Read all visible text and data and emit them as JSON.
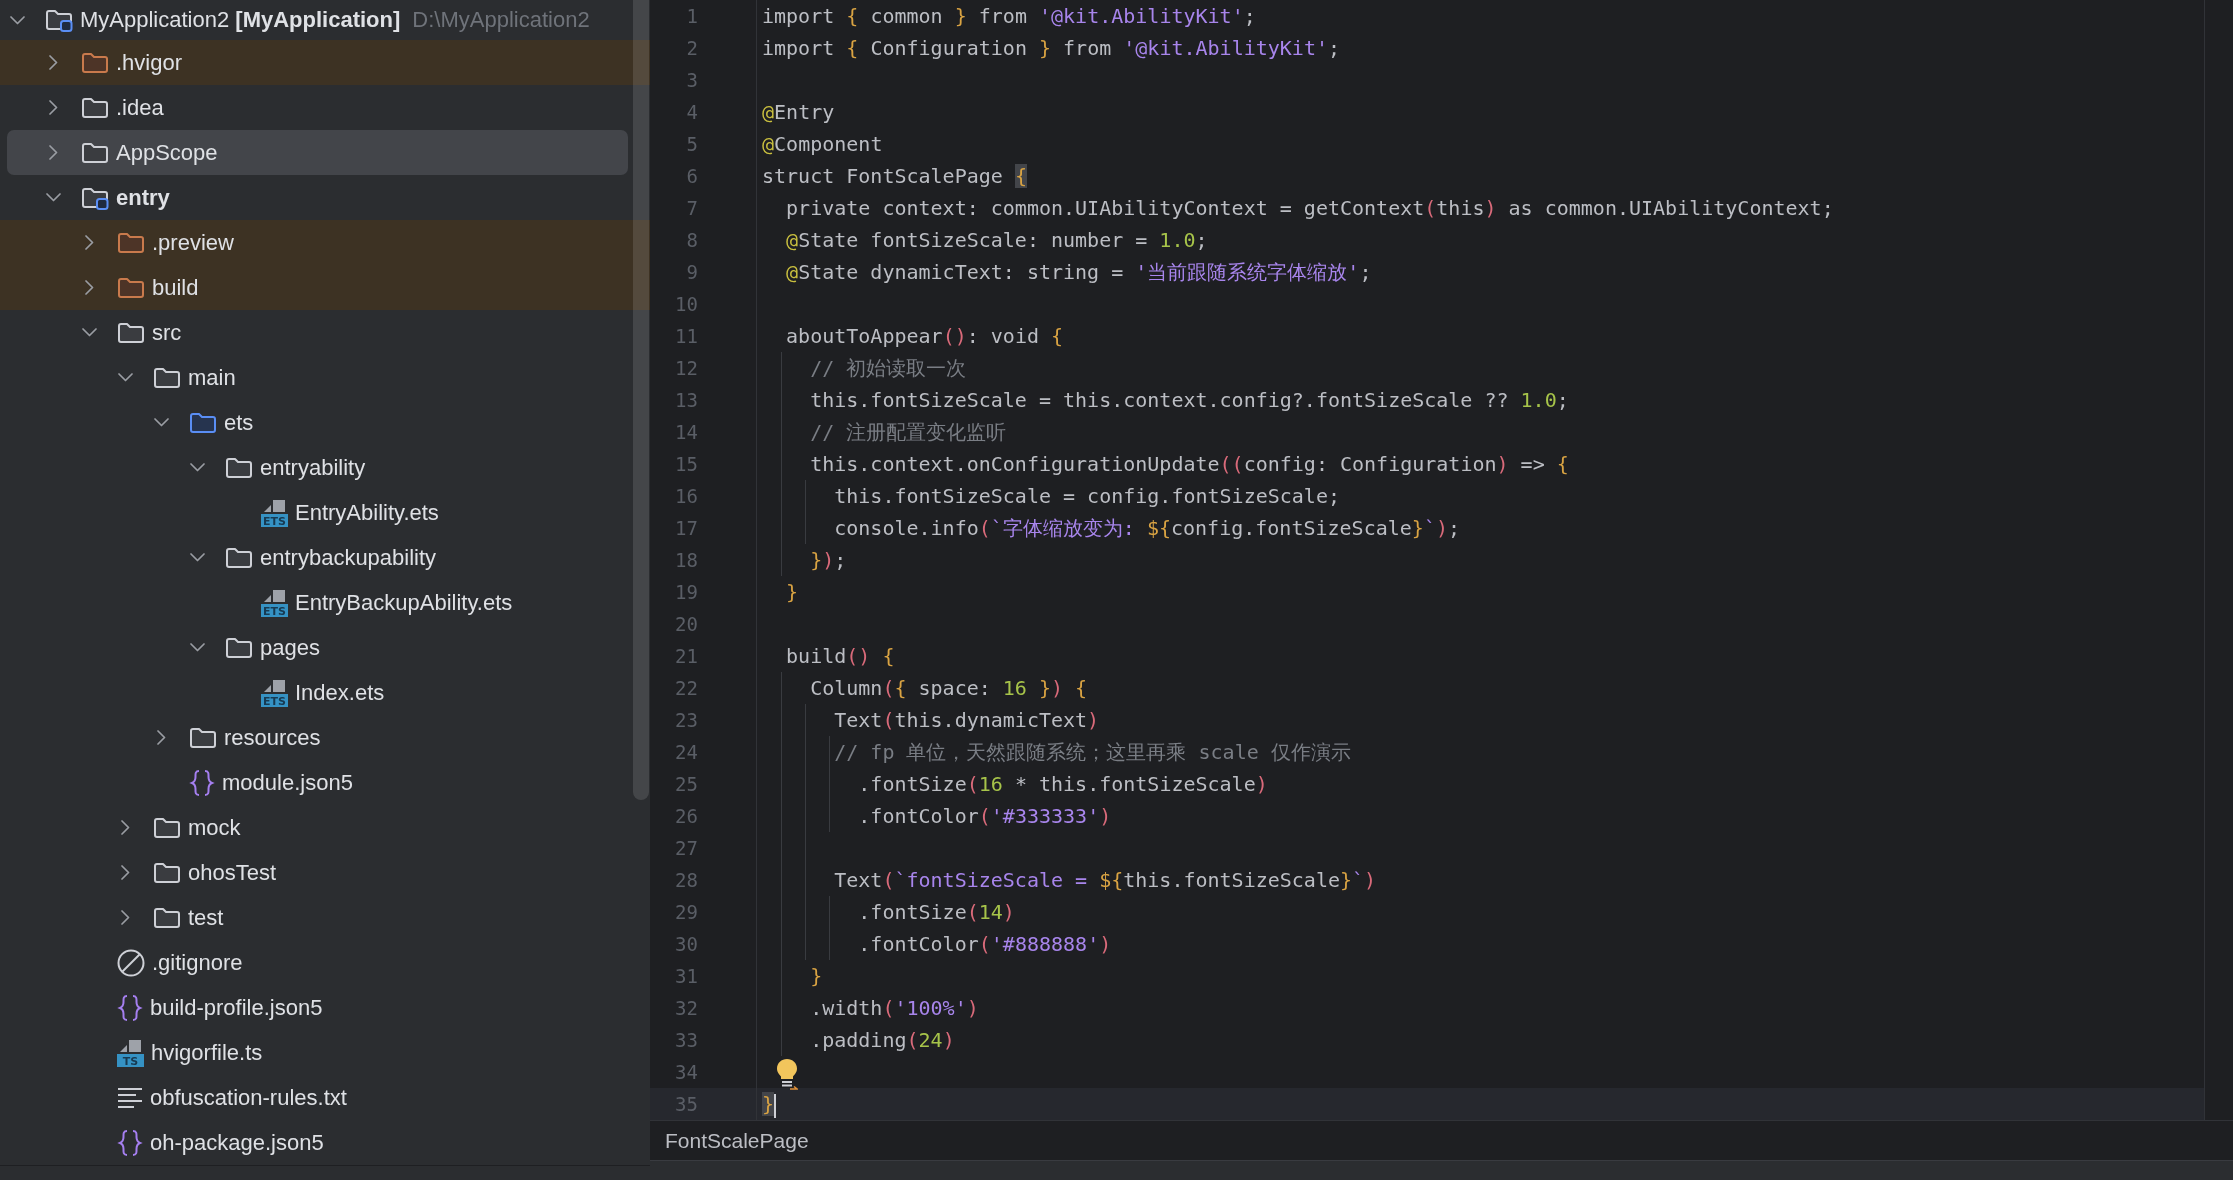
{
  "project_tree": {
    "items": [
      {
        "label": "MyApplication2 **[MyApplication]**",
        "path": "D:\\MyApplication2",
        "kind": "project",
        "expanded": true,
        "selected": false,
        "children": [
          {
            "label": ".hvigor",
            "kind": "excluded",
            "expanded": false,
            "selected": false
          },
          {
            "label": ".idea",
            "kind": "folder",
            "expanded": false,
            "selected": false
          },
          {
            "label": "AppScope",
            "kind": "folder",
            "expanded": false,
            "selected": true
          },
          {
            "label": "entry",
            "kind": "module",
            "expanded": true,
            "selected": false,
            "children": [
              {
                "label": ".preview",
                "kind": "excluded",
                "expanded": false,
                "selected": false
              },
              {
                "label": "build",
                "kind": "excluded",
                "expanded": false,
                "selected": false
              },
              {
                "label": "src",
                "kind": "folder",
                "expanded": true,
                "selected": false,
                "children": [
                  {
                    "label": "main",
                    "kind": "folder",
                    "expanded": true,
                    "selected": false,
                    "children": [
                      {
                        "label": "ets",
                        "kind": "source_root",
                        "expanded": true,
                        "selected": false,
                        "children": [
                          {
                            "label": "entryability",
                            "kind": "folder",
                            "expanded": true,
                            "selected": false,
                            "children": [
                              {
                                "label": "EntryAbility.ets",
                                "kind": "script",
                                "badge": "ETS",
                                "selected": false
                              }
                            ]
                          },
                          {
                            "label": "entrybackupability",
                            "kind": "folder",
                            "expanded": true,
                            "selected": false,
                            "children": [
                              {
                                "label": "EntryBackupAbility.ets",
                                "kind": "script",
                                "badge": "ETS",
                                "selected": false
                              }
                            ]
                          },
                          {
                            "label": "pages",
                            "kind": "folder",
                            "expanded": true,
                            "selected": false,
                            "children": [
                              {
                                "label": "Index.ets",
                                "kind": "script",
                                "badge": "ETS",
                                "selected": false
                              }
                            ]
                          }
                        ]
                      },
                      {
                        "label": "resources",
                        "kind": "folder",
                        "expanded": false,
                        "selected": false
                      },
                      {
                        "label": "module.json5",
                        "kind": "json5",
                        "selected": false
                      }
                    ]
                  },
                  {
                    "label": "mock",
                    "kind": "folder",
                    "expanded": false,
                    "selected": false
                  },
                  {
                    "label": "ohosTest",
                    "kind": "folder",
                    "expanded": false,
                    "selected": false
                  },
                  {
                    "label": "test",
                    "kind": "folder",
                    "expanded": false,
                    "selected": false
                  }
                ]
              },
              {
                "label": ".gitignore",
                "kind": "ignore",
                "selected": false
              },
              {
                "label": "build-profile.json5",
                "kind": "json5",
                "selected": false
              },
              {
                "label": "hvigorfile.ts",
                "kind": "script",
                "badge": "TS",
                "selected": false
              },
              {
                "label": "obfuscation-rules.txt",
                "kind": "text",
                "selected": false
              },
              {
                "label": "oh-package.json5",
                "kind": "json5",
                "selected": false
              }
            ]
          }
        ]
      }
    ]
  },
  "editor": {
    "lines": [
      {
        "number": "1",
        "current": false,
        "tokens": [
          {
            "kind": "plain",
            "text": "import "
          },
          {
            "kind": "brace",
            "text": "{"
          },
          {
            "kind": "plain",
            "text": " common "
          },
          {
            "kind": "brace",
            "text": "}"
          },
          {
            "kind": "plain",
            "text": " from "
          },
          {
            "kind": "str",
            "text": "'@kit.AbilityKit'"
          },
          {
            "kind": "plain",
            "text": ";"
          }
        ]
      },
      {
        "number": "2",
        "current": false,
        "tokens": [
          {
            "kind": "plain",
            "text": "import "
          },
          {
            "kind": "brace",
            "text": "{"
          },
          {
            "kind": "plain",
            "text": " Configuration "
          },
          {
            "kind": "brace",
            "text": "}"
          },
          {
            "kind": "plain",
            "text": " from "
          },
          {
            "kind": "str",
            "text": "'@kit.AbilityKit'"
          },
          {
            "kind": "plain",
            "text": ";"
          }
        ]
      },
      {
        "number": "3",
        "current": false
      },
      {
        "number": "4",
        "current": false,
        "tokens": [
          {
            "kind": "annot",
            "text": "@"
          },
          {
            "kind": "plain",
            "text": "Entry"
          }
        ]
      },
      {
        "number": "5",
        "current": false,
        "tokens": [
          {
            "kind": "annot",
            "text": "@"
          },
          {
            "kind": "plain",
            "text": "Component"
          }
        ]
      },
      {
        "number": "6",
        "current": false,
        "tokens": [
          {
            "kind": "plain",
            "text": "struct FontScalePage "
          },
          {
            "kind": "brace_match",
            "text": "{"
          }
        ]
      },
      {
        "number": "7",
        "current": false,
        "tokens": [
          {
            "kind": "plain",
            "text": "  private context: common.UIAbilityContext = getContext"
          },
          {
            "kind": "paren",
            "text": "("
          },
          {
            "kind": "plain",
            "text": "this"
          },
          {
            "kind": "paren",
            "text": ")"
          },
          {
            "kind": "plain",
            "text": " as common.UIAbilityContext;"
          }
        ]
      },
      {
        "number": "8",
        "current": false,
        "tokens": [
          {
            "kind": "annot",
            "text": "  @"
          },
          {
            "kind": "plain",
            "text": "State fontSizeScale: number = "
          },
          {
            "kind": "num",
            "text": "1.0"
          },
          {
            "kind": "plain",
            "text": ";"
          }
        ]
      },
      {
        "number": "9",
        "current": false,
        "tokens": [
          {
            "kind": "annot",
            "text": "  @"
          },
          {
            "kind": "plain",
            "text": "State dynamicText: string = "
          },
          {
            "kind": "str",
            "text": "'当前跟随系统字体缩放'"
          },
          {
            "kind": "plain",
            "text": ";"
          }
        ]
      },
      {
        "number": "10",
        "current": false
      },
      {
        "number": "11",
        "current": false,
        "tokens": [
          {
            "kind": "plain",
            "text": "  aboutToAppear"
          },
          {
            "kind": "paren",
            "text": "()"
          },
          {
            "kind": "plain",
            "text": ": void "
          },
          {
            "kind": "brace",
            "text": "{"
          }
        ]
      },
      {
        "number": "12",
        "current": false,
        "tokens": [
          {
            "kind": "comment",
            "text": "    // 初始读取一次"
          }
        ]
      },
      {
        "number": "13",
        "current": false,
        "tokens": [
          {
            "kind": "plain",
            "text": "    this.fontSizeScale = this.context.config?.fontSizeScale ?? "
          },
          {
            "kind": "num",
            "text": "1.0"
          },
          {
            "kind": "plain",
            "text": ";"
          }
        ]
      },
      {
        "number": "14",
        "current": false,
        "tokens": [
          {
            "kind": "comment",
            "text": "    // 注册配置变化监听"
          }
        ]
      },
      {
        "number": "15",
        "current": false,
        "tokens": [
          {
            "kind": "plain",
            "text": "    this.context.onConfigurationUpdate"
          },
          {
            "kind": "paren",
            "text": "(("
          },
          {
            "kind": "plain",
            "text": "config: Configuration"
          },
          {
            "kind": "paren",
            "text": ")"
          },
          {
            "kind": "plain",
            "text": " => "
          },
          {
            "kind": "brace",
            "text": "{"
          }
        ]
      },
      {
        "number": "16",
        "current": false,
        "tokens": [
          {
            "kind": "plain",
            "text": "      this.fontSizeScale = config.fontSizeScale;"
          }
        ]
      },
      {
        "number": "17",
        "current": false,
        "tokens": [
          {
            "kind": "plain",
            "text": "      console.info"
          },
          {
            "kind": "paren",
            "text": "("
          },
          {
            "kind": "str",
            "text": "`字体缩放变为: "
          },
          {
            "kind": "brace",
            "text": "${"
          },
          {
            "kind": "plain",
            "text": "config.fontSizeScale"
          },
          {
            "kind": "brace",
            "text": "}"
          },
          {
            "kind": "str",
            "text": "`"
          },
          {
            "kind": "paren",
            "text": ")"
          },
          {
            "kind": "plain",
            "text": ";"
          }
        ]
      },
      {
        "number": "18",
        "current": false,
        "tokens": [
          {
            "kind": "brace",
            "text": "    }"
          },
          {
            "kind": "paren",
            "text": ")"
          },
          {
            "kind": "plain",
            "text": ";"
          }
        ]
      },
      {
        "number": "19",
        "current": false,
        "tokens": [
          {
            "kind": "brace",
            "text": "  }"
          }
        ]
      },
      {
        "number": "20",
        "current": false
      },
      {
        "number": "21",
        "current": false,
        "tokens": [
          {
            "kind": "plain",
            "text": "  build"
          },
          {
            "kind": "paren",
            "text": "()"
          },
          {
            "kind": "brace",
            "text": " {"
          }
        ]
      },
      {
        "number": "22",
        "current": false,
        "tokens": [
          {
            "kind": "plain",
            "text": "    Column"
          },
          {
            "kind": "paren",
            "text": "("
          },
          {
            "kind": "brace",
            "text": "{"
          },
          {
            "kind": "plain",
            "text": " space: "
          },
          {
            "kind": "num",
            "text": "16"
          },
          {
            "kind": "brace",
            "text": " }"
          },
          {
            "kind": "paren",
            "text": ")"
          },
          {
            "kind": "brace",
            "text": " {"
          }
        ]
      },
      {
        "number": "23",
        "current": false,
        "tokens": [
          {
            "kind": "plain",
            "text": "      Text"
          },
          {
            "kind": "paren",
            "text": "("
          },
          {
            "kind": "plain",
            "text": "this.dynamicText"
          },
          {
            "kind": "paren",
            "text": ")"
          }
        ]
      },
      {
        "number": "24",
        "current": false,
        "tokens": [
          {
            "kind": "comment",
            "text": "      // fp 单位，天然跟随系统；这里再乘 scale 仅作演示"
          }
        ]
      },
      {
        "number": "25",
        "current": false,
        "tokens": [
          {
            "kind": "plain",
            "text": "        .fontSize"
          },
          {
            "kind": "paren",
            "text": "("
          },
          {
            "kind": "num",
            "text": "16"
          },
          {
            "kind": "plain",
            "text": " * this.fontSizeScale"
          },
          {
            "kind": "paren",
            "text": ")"
          }
        ]
      },
      {
        "number": "26",
        "current": false,
        "tokens": [
          {
            "kind": "plain",
            "text": "        .fontColor"
          },
          {
            "kind": "paren",
            "text": "("
          },
          {
            "kind": "str",
            "text": "'#333333'"
          },
          {
            "kind": "paren",
            "text": ")"
          }
        ]
      },
      {
        "number": "27",
        "current": false
      },
      {
        "number": "28",
        "current": false,
        "tokens": [
          {
            "kind": "plain",
            "text": "      Text"
          },
          {
            "kind": "paren",
            "text": "("
          },
          {
            "kind": "str",
            "text": "`fontSizeScale = "
          },
          {
            "kind": "brace",
            "text": "${"
          },
          {
            "kind": "plain",
            "text": "this.fontSizeScale"
          },
          {
            "kind": "brace",
            "text": "}"
          },
          {
            "kind": "str",
            "text": "`"
          },
          {
            "kind": "paren",
            "text": ")"
          }
        ]
      },
      {
        "number": "29",
        "current": false,
        "tokens": [
          {
            "kind": "plain",
            "text": "        .fontSize"
          },
          {
            "kind": "paren",
            "text": "("
          },
          {
            "kind": "num",
            "text": "14"
          },
          {
            "kind": "paren",
            "text": ")"
          }
        ]
      },
      {
        "number": "30",
        "current": false,
        "tokens": [
          {
            "kind": "plain",
            "text": "        .fontColor"
          },
          {
            "kind": "paren",
            "text": "("
          },
          {
            "kind": "str",
            "text": "'#888888'"
          },
          {
            "kind": "paren",
            "text": ")"
          }
        ]
      },
      {
        "number": "31",
        "current": false,
        "tokens": [
          {
            "kind": "brace",
            "text": "    }"
          }
        ]
      },
      {
        "number": "32",
        "current": false,
        "tokens": [
          {
            "kind": "plain",
            "text": "    .width"
          },
          {
            "kind": "paren",
            "text": "("
          },
          {
            "kind": "str",
            "text": "'100%'"
          },
          {
            "kind": "paren",
            "text": ")"
          }
        ]
      },
      {
        "number": "33",
        "current": false,
        "tokens": [
          {
            "kind": "plain",
            "text": "    .padding"
          },
          {
            "kind": "paren",
            "text": "("
          },
          {
            "kind": "num",
            "text": "24"
          },
          {
            "kind": "paren",
            "text": ")"
          }
        ]
      },
      {
        "number": "34",
        "current": false,
        "bulb": true
      },
      {
        "number": "35",
        "current": true,
        "tokens": [
          {
            "kind": "brace_match",
            "text": "}"
          }
        ]
      }
    ]
  },
  "breadcrumb": {
    "items": [
      "FontScalePage"
    ]
  }
}
